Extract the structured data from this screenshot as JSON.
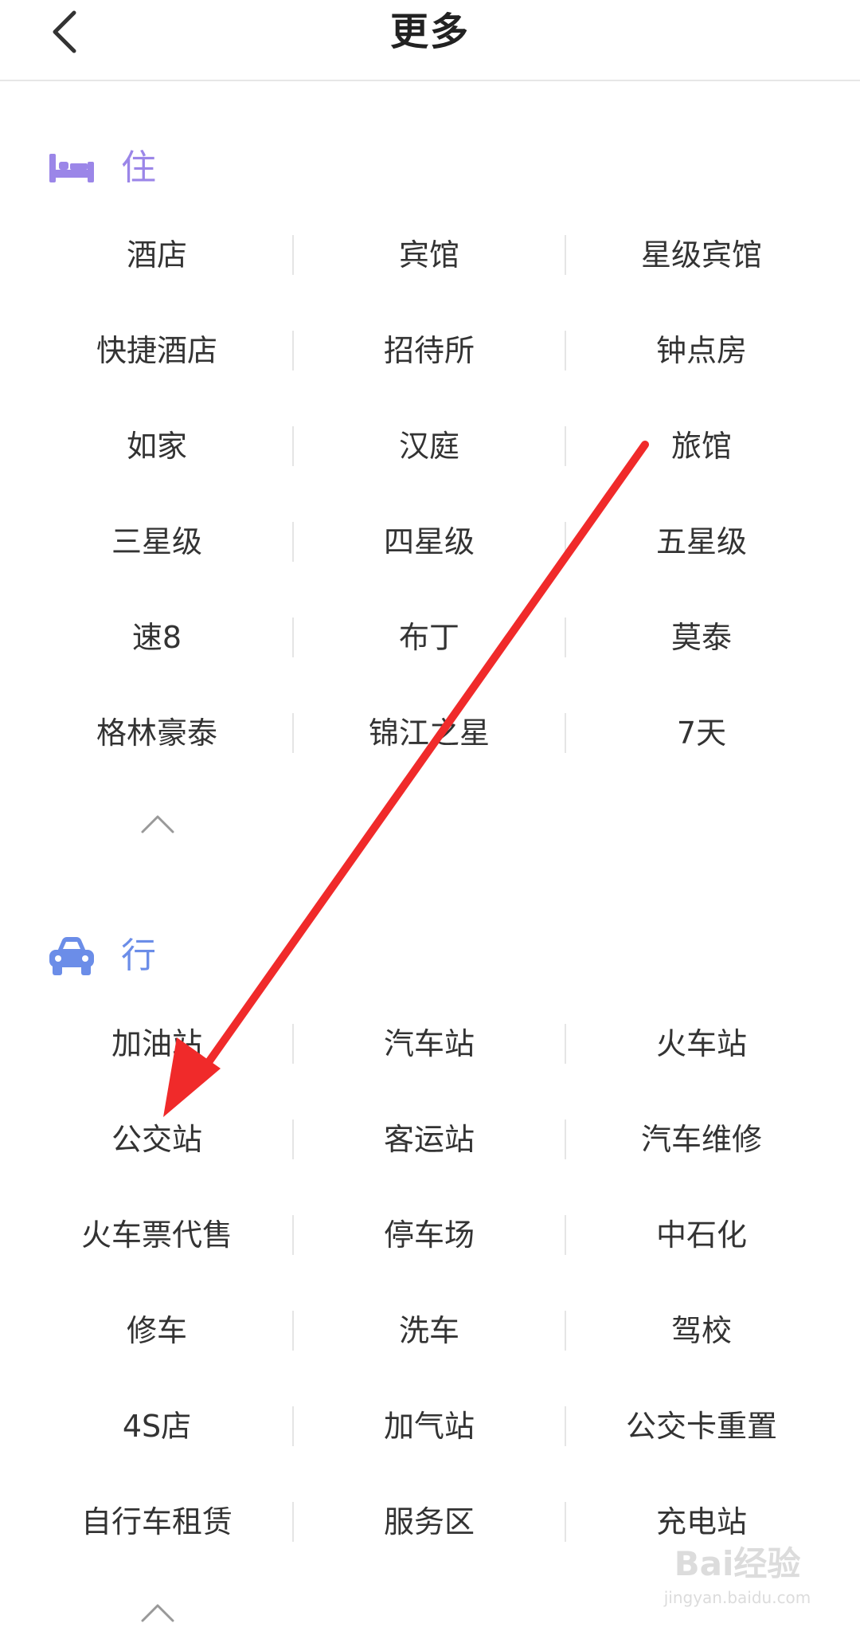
{
  "header": {
    "title": "更多",
    "back_icon": "chevron-left-icon"
  },
  "sections": [
    {
      "label": "住",
      "icon": "bed-icon",
      "color": "#9b86e8",
      "rows": [
        [
          "酒店",
          "宾馆",
          "星级宾馆"
        ],
        [
          "快捷酒店",
          "招待所",
          "钟点房"
        ],
        [
          "如家",
          "汉庭",
          "旅馆"
        ],
        [
          "三星级",
          "四星级",
          "五星级"
        ],
        [
          "速8",
          "布丁",
          "莫泰"
        ],
        [
          "格林豪泰",
          "锦江之星",
          "7天"
        ]
      ],
      "collapse_icon": "chevron-up-icon"
    },
    {
      "label": "行",
      "icon": "car-icon",
      "color": "#6b8de8",
      "rows": [
        [
          "加油站",
          "汽车站",
          "火车站"
        ],
        [
          "公交站",
          "客运站",
          "汽车维修"
        ],
        [
          "火车票代售",
          "停车场",
          "中石化"
        ],
        [
          "修车",
          "洗车",
          "驾校"
        ],
        [
          "4S店",
          "加气站",
          "公交卡重置"
        ],
        [
          "自行车租赁",
          "服务区",
          "充电站"
        ]
      ],
      "collapse_icon": "chevron-up-icon"
    }
  ],
  "annotation": {
    "color": "#f02a2a"
  },
  "watermark": {
    "logo": "Bai经验",
    "sub": "jingyan.baidu.com"
  }
}
